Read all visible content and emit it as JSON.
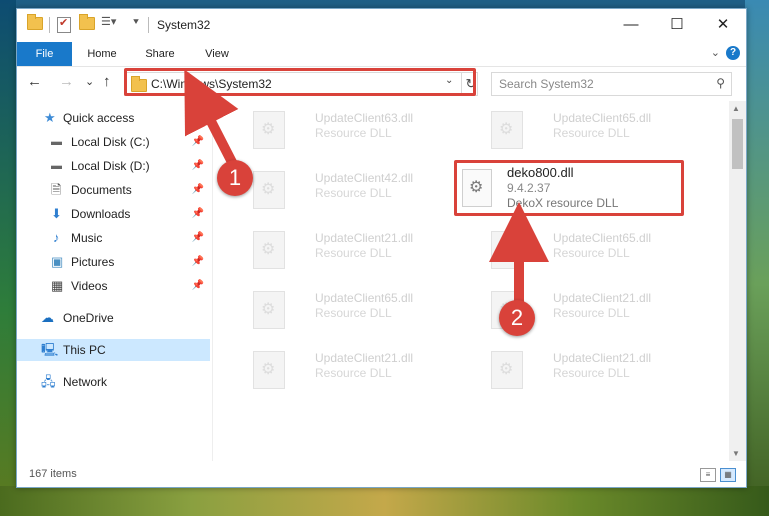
{
  "window": {
    "title": "System32",
    "minimize_label": "—",
    "maximize_label": "☐",
    "close_label": "✕"
  },
  "ribbon": {
    "tabs": [
      "File",
      "Home",
      "Share",
      "View"
    ],
    "collapse_glyph": "⌄",
    "help_glyph": "?"
  },
  "nav": {
    "back_glyph": "←",
    "forward_glyph": "→",
    "recent_glyph": "⌄",
    "up_glyph": "↑",
    "address": "C:\\Windows\\System32",
    "refresh_glyph": "↻",
    "dropdown_glyph": "⌄",
    "search_placeholder": "Search System32",
    "search_glyph": "⚲"
  },
  "sidebar": {
    "items": [
      {
        "label": "Quick access",
        "icon": "star-icon",
        "glyph": "★",
        "color": "#3d8bd6"
      },
      {
        "label": "Local Disk (C:)",
        "icon": "drive-icon",
        "glyph": "▬",
        "color": "#666666"
      },
      {
        "label": "Local Disk (D:)",
        "icon": "drive-icon",
        "glyph": "▬",
        "color": "#666666"
      },
      {
        "label": "Documents",
        "icon": "document-icon",
        "glyph": "🗎",
        "color": "#555555"
      },
      {
        "label": "Downloads",
        "icon": "download-icon",
        "glyph": "⬇",
        "color": "#2f7fd0"
      },
      {
        "label": "Music",
        "icon": "music-icon",
        "glyph": "♪",
        "color": "#2f7fd0"
      },
      {
        "label": "Pictures",
        "icon": "pictures-icon",
        "glyph": "▣",
        "color": "#4a90c2"
      },
      {
        "label": "Videos",
        "icon": "video-icon",
        "glyph": "▦",
        "color": "#444444"
      },
      {
        "label": "OneDrive",
        "icon": "cloud-icon",
        "glyph": "☁",
        "color": "#1a6fc0"
      },
      {
        "label": "This PC",
        "icon": "computer-icon",
        "glyph": "🖳",
        "color": "#2f7fd0"
      },
      {
        "label": "Network",
        "icon": "network-icon",
        "glyph": "🖧",
        "color": "#2f7fd0"
      }
    ],
    "pin_glyph": "📌"
  },
  "files": [
    {
      "name": "UpdateClient63.dll",
      "desc": "Resource DLL"
    },
    {
      "name": "UpdateClient65.dll",
      "desc": "Resource DLL"
    },
    {
      "name": "UpdateClient42.dll",
      "desc": "Resource DLL"
    },
    {
      "name": "UpdateClient21.dll",
      "desc": "Resource DLL"
    },
    {
      "name": "UpdateClient65.dll",
      "desc": "Resource DLL"
    },
    {
      "name": "UpdateClient65.dll",
      "desc": "Resource DLL"
    },
    {
      "name": "UpdateClient21.dll",
      "desc": "Resource DLL"
    },
    {
      "name": "UpdateClient21.dll",
      "desc": "Resource DLL"
    },
    {
      "name": "UpdateClient21.dll",
      "desc": "Resource DLL"
    }
  ],
  "highlighted_file": {
    "name": "deko800.dll",
    "version": "9.4.2.37",
    "desc": "DekoX resource DLL"
  },
  "status": {
    "item_count": "167 items"
  },
  "annotations": {
    "marker_1": "1",
    "marker_2": "2",
    "highlight_color": "#d9423a"
  }
}
